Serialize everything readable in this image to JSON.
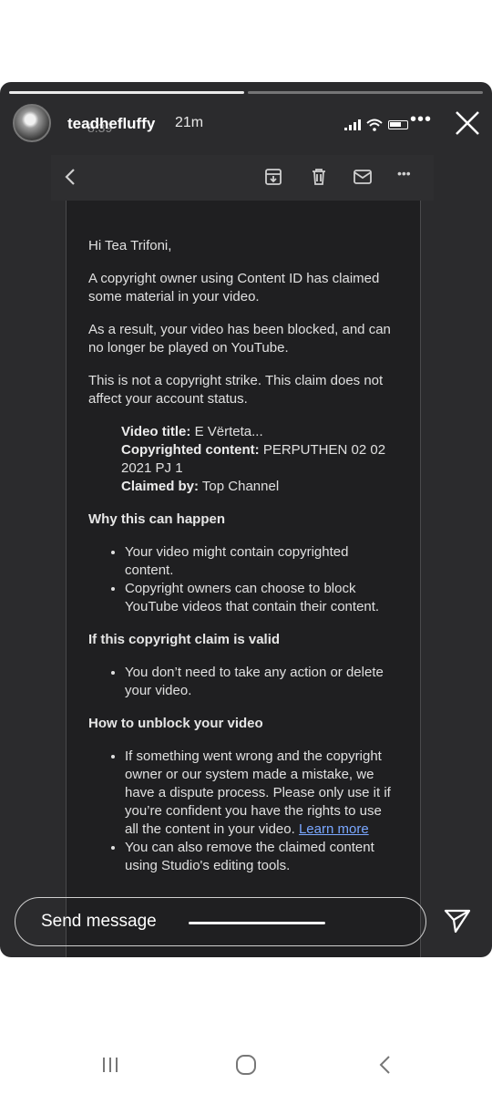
{
  "story": {
    "username": "teadhefluffy",
    "time_ago": "21m",
    "status_time_ghost": "8:39",
    "more_label": "•••",
    "progress_segments": 2,
    "active_segment": 0
  },
  "email_toolbar": {
    "icons": [
      "back-arrow-icon",
      "archive-icon",
      "delete-icon",
      "mail-icon",
      "more-dots-icon"
    ],
    "more_label": "•••"
  },
  "email": {
    "greeting": "Hi Tea Trifoni,",
    "para1": "A copyright owner using Content ID has claimed some material in your video.",
    "para2": "As a result, your video has been blocked, and can no longer be played on YouTube.",
    "para3": "This is not a copyright strike. This claim does not affect your account status.",
    "video_title_label": "Video title:",
    "video_title_value": " E Vërteta...",
    "copyrighted_label": "Copyrighted content:",
    "copyrighted_value": " PERPUTHEN 02 02 2021 PJ 1",
    "claimed_by_label": "Claimed by:",
    "claimed_by_value": " Top Channel",
    "why_heading": "Why this can happen",
    "why_items": [
      "Your video might contain copyrighted content.",
      "Copyright owners can choose to block YouTube videos that contain their content."
    ],
    "valid_heading": "If this copyright claim is valid",
    "valid_items": [
      "You don’t need to take any action or delete your video."
    ],
    "unblock_heading": "How to unblock your video",
    "unblock_item1": "If something went wrong and the copyright owner or our system made a mistake, we have a dispute process. Please only use it if you’re confident you have the rights to use all the content in your video. ",
    "learn_more": "Learn more",
    "unblock_item2": "You can also remove the claimed content using Studio's editing tools."
  },
  "reply": {
    "placeholder": "Send message"
  },
  "navbar": {
    "icons": [
      "recent-apps-icon",
      "home-icon",
      "back-icon"
    ]
  }
}
